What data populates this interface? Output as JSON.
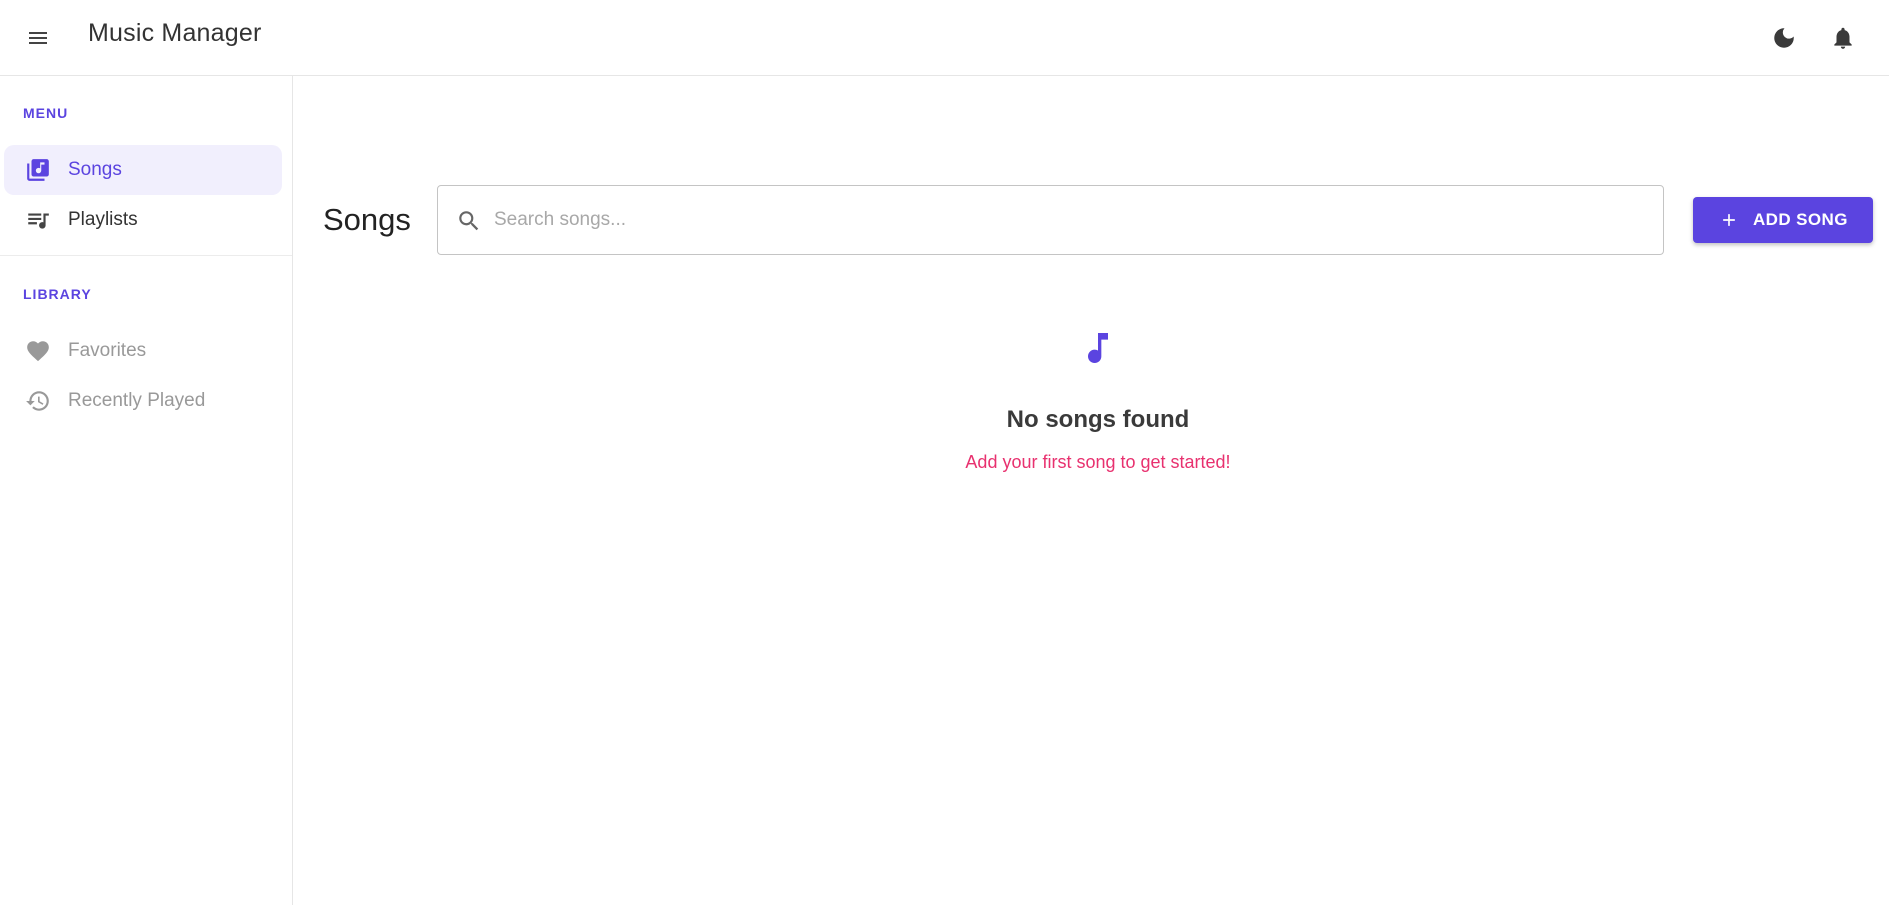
{
  "app": {
    "title": "Music Manager"
  },
  "header": {
    "menu_icon": "menu-icon",
    "theme_icon": "moon-icon",
    "notification_icon": "bell-icon"
  },
  "sidebar": {
    "sections": [
      {
        "label": "MENU",
        "items": [
          {
            "label": "Songs",
            "icon": "music-library-icon",
            "active": true
          },
          {
            "label": "Playlists",
            "icon": "queue-music-icon",
            "active": false
          }
        ]
      },
      {
        "label": "LIBRARY",
        "items": [
          {
            "label": "Favorites",
            "icon": "heart-icon",
            "active": false
          },
          {
            "label": "Recently Played",
            "icon": "history-icon",
            "active": false
          }
        ]
      }
    ]
  },
  "main": {
    "title": "Songs",
    "search": {
      "placeholder": "Search songs...",
      "value": ""
    },
    "add_button": {
      "label": "ADD SONG",
      "icon": "plus-icon"
    },
    "empty_state": {
      "icon": "music-note-icon",
      "title": "No songs found",
      "subtitle": "Add your first song to get started!"
    }
  },
  "colors": {
    "accent": "#5b44e0",
    "active_bg": "#f1effd",
    "empty_subtitle": "#e8316f",
    "muted_text": "#999999"
  }
}
